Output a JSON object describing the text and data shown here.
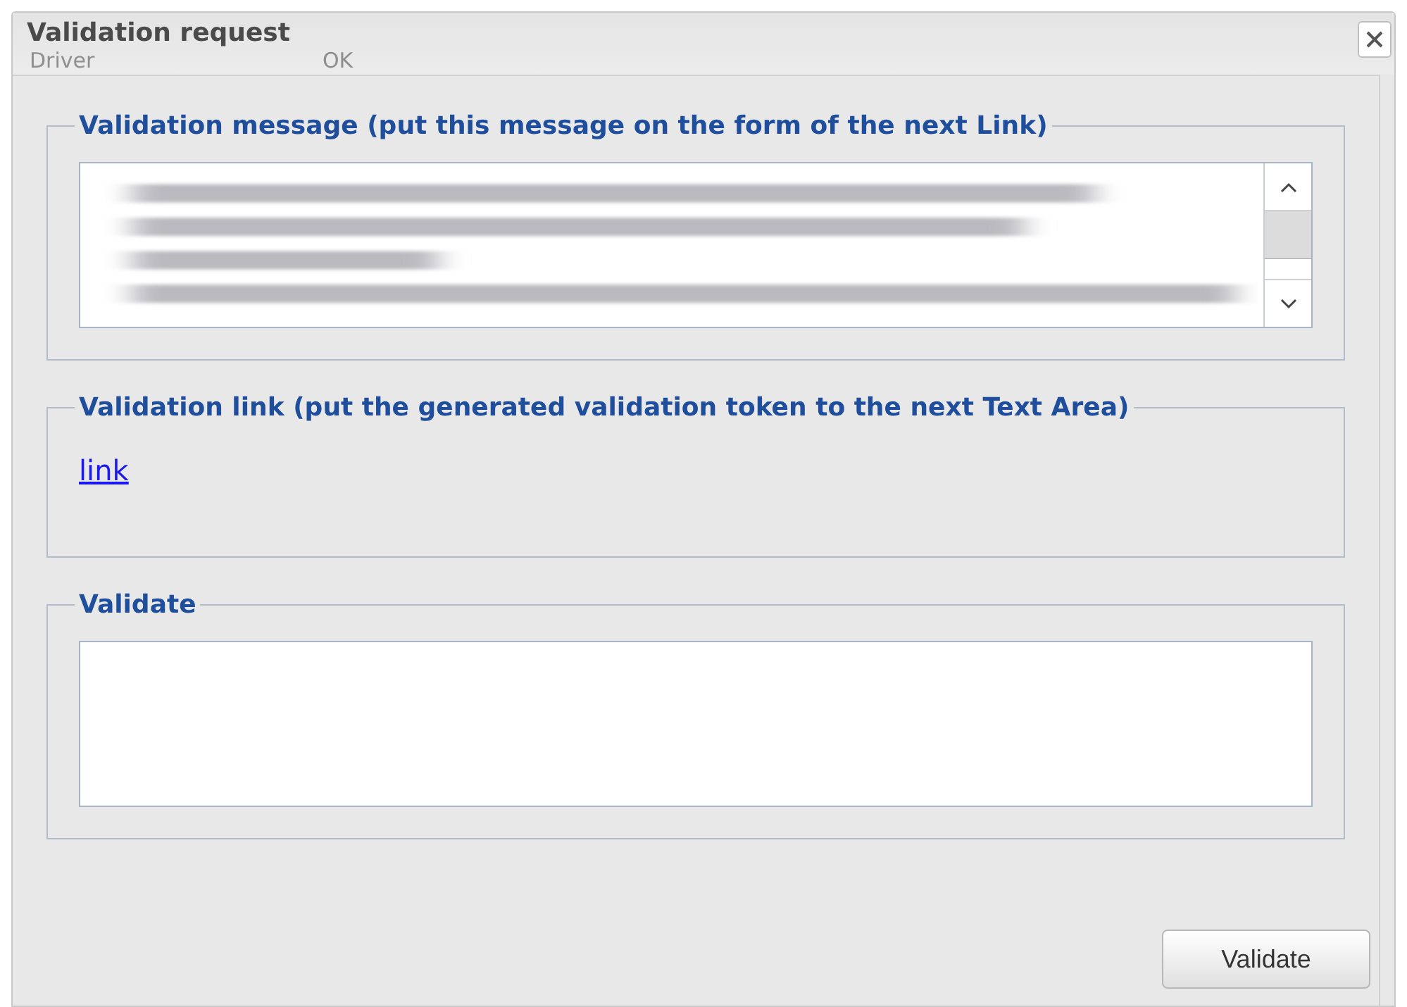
{
  "window": {
    "title": "Validation request"
  },
  "background_labels": [
    "Driver",
    "OK"
  ],
  "sections": [
    {
      "kind": "message",
      "legend": "Validation message (put this message on the form of the next Link)"
    },
    {
      "kind": "link",
      "legend": "Validation link (put the generated validation token to the next Text Area)",
      "link": "link"
    },
    {
      "kind": "input",
      "legend": "Validate"
    }
  ],
  "buttons": [
    "Validate"
  ]
}
